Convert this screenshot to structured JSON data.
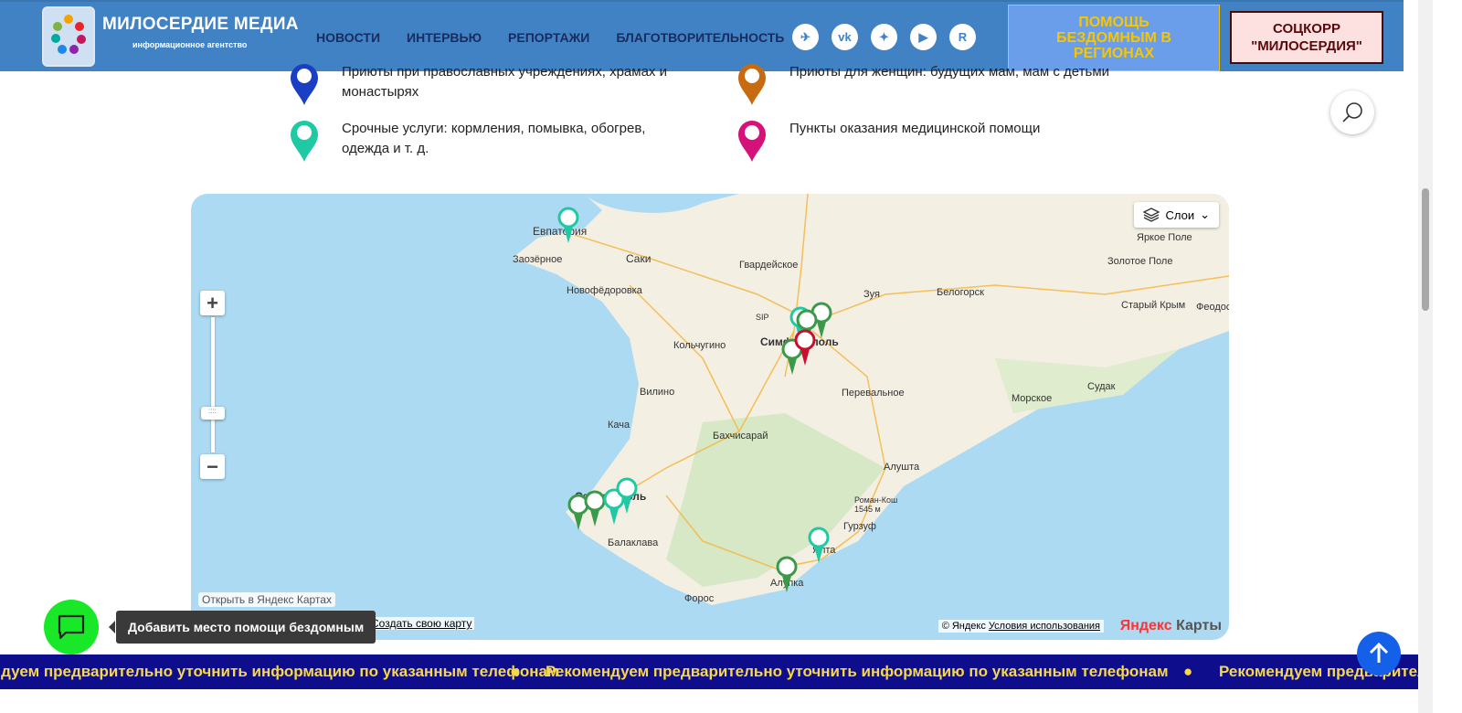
{
  "header": {
    "brand": "МИЛОСЕРДИЕ МЕДИА",
    "brand_sub": "информационное агентство",
    "nav": [
      "НОВОСТИ",
      "ИНТЕРВЬЮ",
      "РЕПОРТАЖИ",
      "БЛАГОТВОРИТЕЛЬНОСТЬ"
    ],
    "socials": [
      {
        "icon": "telegram-icon",
        "glyph": "✈"
      },
      {
        "icon": "vk-icon",
        "glyph": "vk"
      },
      {
        "icon": "dzen-icon",
        "glyph": "✦"
      },
      {
        "icon": "rutube-icon",
        "glyph": "▶"
      },
      {
        "icon": "rutube-r-icon",
        "glyph": "R"
      }
    ],
    "help_button": "ПОМОЩЬ БЕЗДОМНЫМ В РЕГИОНАХ",
    "corr_button": "СОЦКОРР \"МИЛОСЕРДИЯ\""
  },
  "legend": [
    {
      "label": "Приюты при православных учреждениях, храмах и монастырях",
      "color": "#1a3fc4"
    },
    {
      "label": "Приюты для женщин: будущих мам, мам с детьми",
      "color": "#c86a10"
    },
    {
      "label": "Срочные услуги: кормления, помывка, обогрев, одежда и т. д.",
      "color": "#1fc9a4"
    },
    {
      "label": "Пункты оказания медицинской помощи",
      "color": "#d6127a"
    }
  ],
  "map": {
    "layers_label": "Слои",
    "zoom_in": "+",
    "zoom_out": "−",
    "open_label": "Открыть в Яндекс Картах",
    "create_label": "Создать свою карту",
    "copyright": "© Яндекс",
    "terms": "Условия использования",
    "brand_a": "Яндекс",
    "brand_b": " Карты",
    "cities": [
      "Евпатория",
      "Заозёрное",
      "Саки",
      "Гвардейское",
      "Новофёдоровка",
      "SIP",
      "Симферополь",
      "Зуя",
      "Белогорск",
      "Яркое Поле",
      "Золотое Поле",
      "Старый Крым",
      "Феодосия",
      "Кольчугино",
      "Перевальное",
      "Морское",
      "Судак",
      "Вилино",
      "Кача",
      "Бахчисарай",
      "Алушта",
      "Роман-Кош 1545 м",
      "Гурзуф",
      "Севастополь",
      "Балаклава",
      "Ялта",
      "Алупка",
      "Форос"
    ]
  },
  "ticker": "Рекомендуем предварительно уточнить информацию по указанным телефонам",
  "chat_tooltip": "Добавить место помощи бездомным"
}
